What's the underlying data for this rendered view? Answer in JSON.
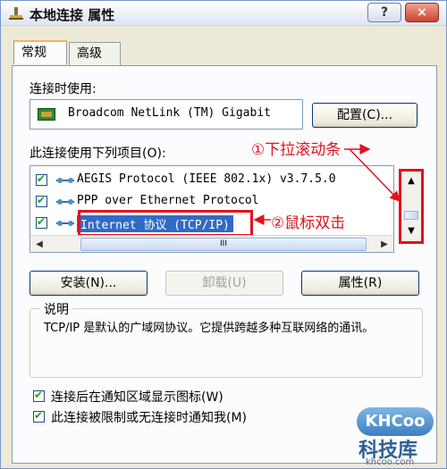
{
  "window": {
    "title": "本地连接 属性",
    "help_label": "?",
    "close_label": "×"
  },
  "tabs": [
    {
      "label": "常规",
      "active": true
    },
    {
      "label": "高级",
      "active": false
    }
  ],
  "connect_using": {
    "label": "连接时使用:",
    "adapter": "Broadcom NetLink (TM) Gigabit",
    "configure_button": "配置(C)..."
  },
  "components": {
    "label": "此连接使用下列项目(O):",
    "items": [
      {
        "text": "AEGIS Protocol (IEEE 802.1x) v3.7.5.0",
        "checked": true
      },
      {
        "text": "PPP over Ethernet Protocol",
        "checked": true
      },
      {
        "text": "Internet 协议 (TCP/IP)",
        "checked": true,
        "selected": true
      }
    ],
    "hscroll_grip": "III"
  },
  "annotations": {
    "scroll": "①下拉滚动条",
    "double_click": "②鼠标双击"
  },
  "buttons": {
    "install": "安装(N)...",
    "uninstall": "卸载(U)",
    "properties": "属性(R)"
  },
  "description": {
    "title": "说明",
    "text": "TCP/IP 是默认的广域网协议。它提供跨越多种互联网络的通讯。"
  },
  "options": [
    {
      "label": "连接后在通知区域显示图标(W)",
      "checked": true
    },
    {
      "label": "此连接被限制或无连接时通知我(M)",
      "checked": true
    }
  ],
  "watermark": {
    "badge": "KHCoo",
    "name": "科技库",
    "url": "khcoo.com"
  },
  "colors": {
    "annotation_red": "#e3121b",
    "selection_blue": "#316ac5"
  }
}
